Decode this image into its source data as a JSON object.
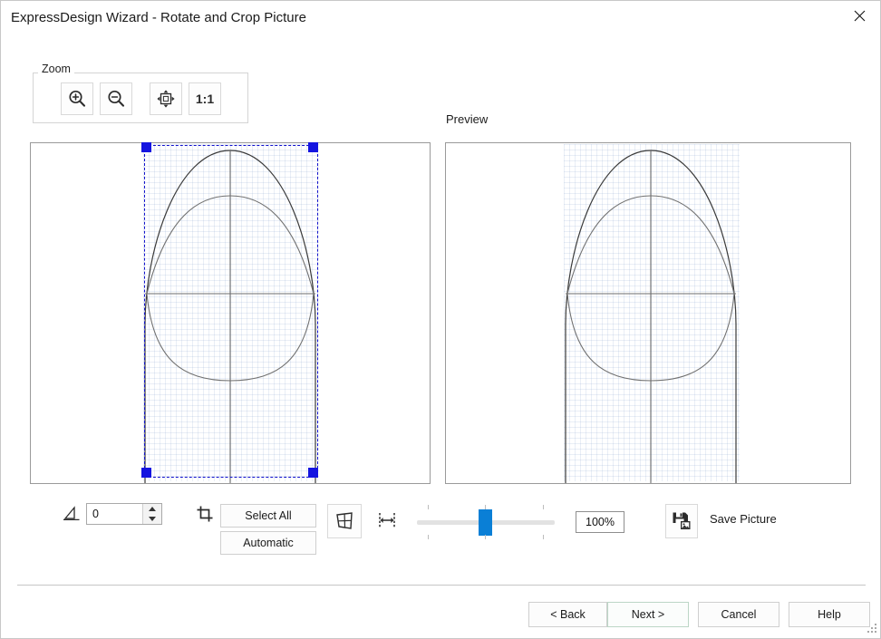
{
  "window": {
    "title": "ExpressDesign Wizard - Rotate and Crop Picture",
    "close_icon": "close-icon"
  },
  "zoom_group": {
    "legend": "Zoom",
    "buttons": [
      {
        "name": "zoom-in-button",
        "icon": "zoom-in-icon",
        "label": ""
      },
      {
        "name": "zoom-out-button",
        "icon": "zoom-out-icon",
        "label": ""
      },
      {
        "name": "zoom-fit-button",
        "icon": "fit-to-window-icon",
        "label": ""
      },
      {
        "name": "zoom-actual-size-button",
        "icon": "one-to-one-icon",
        "label": "1:1"
      }
    ]
  },
  "preview": {
    "label": "Preview"
  },
  "image_area": {
    "selection": {
      "handles": 4,
      "border_color": "#1111cc",
      "handle_color": "#1414e0"
    },
    "grid_color": "#7896c8"
  },
  "controls": {
    "angle_icon": "angle-icon",
    "angle_value": "0",
    "angle_placeholder": "0",
    "crop_icon": "crop-icon",
    "select_all_label": "Select All",
    "automatic_label": "Automatic",
    "perspective_icon": "perspective-correct-icon",
    "width_icon": "adjust-width-icon",
    "zoom_slider_value": 45,
    "zoom_percent": "100%",
    "save_picture_icon": "save-picture-icon",
    "save_picture_label": "Save Picture"
  },
  "footer": {
    "back_label": "< Back",
    "next_label": "Next >",
    "cancel_label": "Cancel",
    "help_label": "Help"
  },
  "colors": {
    "accent": "#0a7fd6",
    "selection": "#1414e0",
    "default_button_border": "#bcd6c6"
  }
}
